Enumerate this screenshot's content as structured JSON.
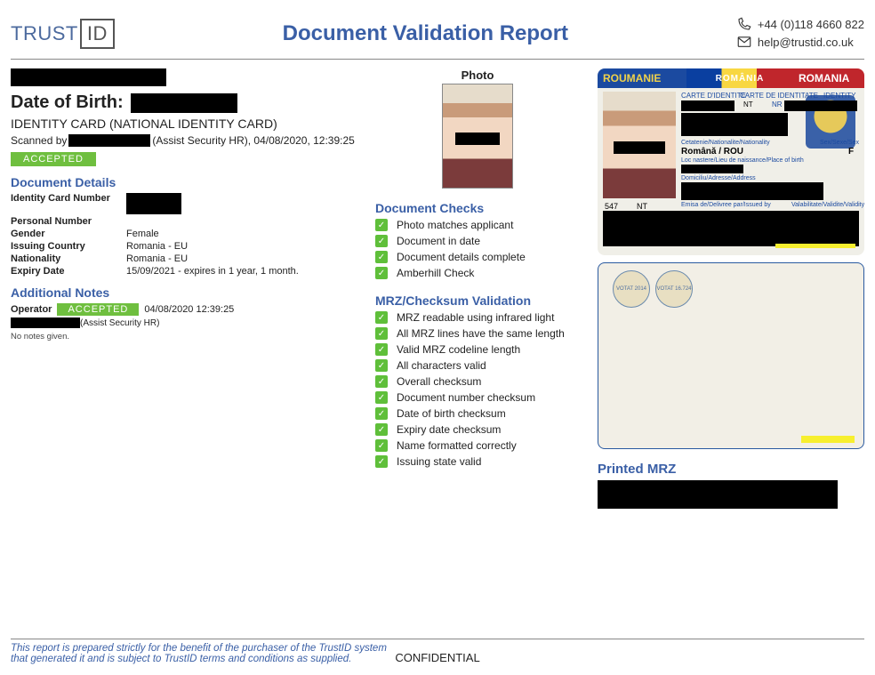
{
  "brand": {
    "part1": "TRUST",
    "part2": "ID"
  },
  "title": "Document Validation Report",
  "contact": {
    "phone": "+44 (0)118 4660 822",
    "email": "help@trustid.co.uk"
  },
  "person": {
    "dob_label": "Date of Birth:",
    "doc_type": "IDENTITY CARD (NATIONAL IDENTITY CARD)",
    "scanned_prefix": "Scanned by",
    "scanned_suffix": "(Assist Security HR), 04/08/2020, 12:39:25",
    "status": "ACCEPTED"
  },
  "details": {
    "heading": "Document Details",
    "rows": [
      {
        "label": "Identity Card Number",
        "value": "",
        "redacted": true
      },
      {
        "label": "Personal Number",
        "value": "",
        "redacted": false
      },
      {
        "label": "Gender",
        "value": "Female",
        "redacted": false
      },
      {
        "label": "Issuing Country",
        "value": "Romania - EU",
        "redacted": false
      },
      {
        "label": "Nationality",
        "value": "Romania - EU",
        "redacted": false
      },
      {
        "label": "Expiry Date",
        "value": "15/09/2021 - expires in 1 year, 1 month.",
        "redacted": false
      }
    ]
  },
  "notes": {
    "heading": "Additional Notes",
    "operator_label": "Operator",
    "status": "ACCEPTED",
    "timestamp": "04/08/2020 12:39:25",
    "by_suffix": "(Assist Security HR)",
    "none": "No notes given."
  },
  "photo_label": "Photo",
  "checks": {
    "heading": "Document Checks",
    "items": [
      "Photo matches applicant",
      "Document in date",
      "Document details complete",
      "Amberhill Check"
    ]
  },
  "mrz": {
    "heading": "MRZ/Checksum Validation",
    "items": [
      "MRZ readable using infrared light",
      "All MRZ lines have the same length",
      "Valid MRZ codeline length",
      "All characters valid",
      "Overall checksum",
      "Document number checksum",
      "Date of birth checksum",
      "Expiry date checksum",
      "Name formatted correctly",
      "Issuing state valid"
    ]
  },
  "idcard": {
    "left_label": "ROUMANIE",
    "mid_label": "ROMÂNIA",
    "right_label": "ROMANIA",
    "line_carte": "CARTE D'IDENTITE",
    "line_carte2": "CARTE DE IDENTITATE",
    "line_idcard": "IDENTITY CARD",
    "nt": "NT",
    "nr": "NR",
    "nationality_line": "Cetatenie/Nationalite/Nationality",
    "nationality_value": "Română / ROU",
    "birth_line": "Loc nastere/Lieu de naissance/Place of birth",
    "address_line": "Domiciliu/Adresse/Address",
    "sex_label": "Sex/Sexe/Sex",
    "sex_value": "F",
    "issued_line": "Emisa de/Delivree par/Issued by",
    "validity_line": "Valabilitate/Validite/Validity",
    "series_547": "547"
  },
  "back_stamp1": "VOTAT 2014",
  "back_stamp2": "VOTAT 16.724",
  "printed_mrz": "Printed MRZ",
  "footer": {
    "line1": "This report is prepared strictly for the benefit of the purchaser of the TrustID system",
    "line2": "that generated it and is subject to TrustID terms and conditions as supplied.",
    "confidential": "CONFIDENTIAL"
  }
}
